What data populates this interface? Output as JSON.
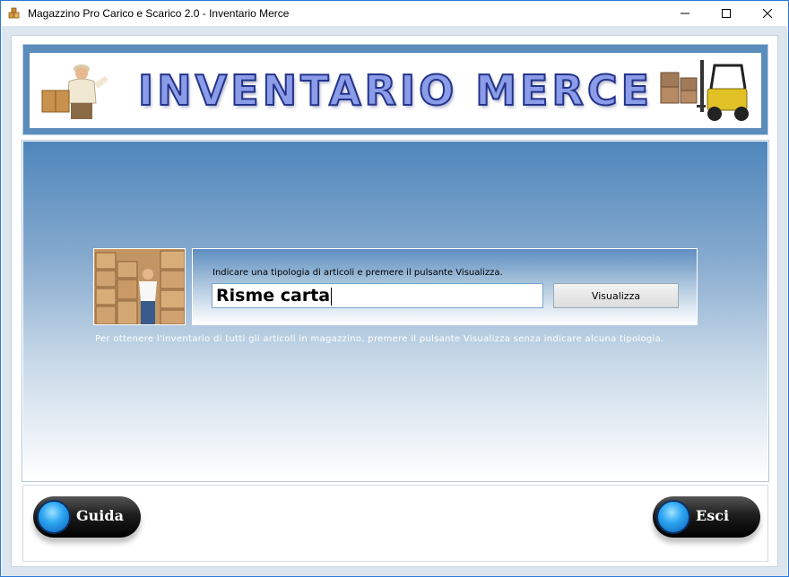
{
  "window": {
    "title": "Magazzino Pro Carico e Scarico 2.0 - Inventario Merce"
  },
  "banner": {
    "title": "INVENTARIO MERCE"
  },
  "form": {
    "label": "Indicare una tipologia di articoli e premere il pulsante Visualizza.",
    "search_value": "Risme carta",
    "view_button": "Visualizza",
    "hint": "Per ottenere l'inventario di tutti gli articoli in magazzino, premere il pulsante Visualizza senza indicare alcuna tipologia."
  },
  "buttons": {
    "help": "Guida",
    "exit": "Esci"
  },
  "icons": {
    "app": "warehouse-boxes-icon",
    "minimize": "minimize-icon",
    "maximize": "maximize-icon",
    "close": "close-icon",
    "delivery_man": "delivery-man-icon",
    "forklift": "forklift-icon"
  },
  "colors": {
    "accent": "#2b79d8",
    "banner_title": "#8b9ce8",
    "button_orb": "#2ea7f2"
  }
}
